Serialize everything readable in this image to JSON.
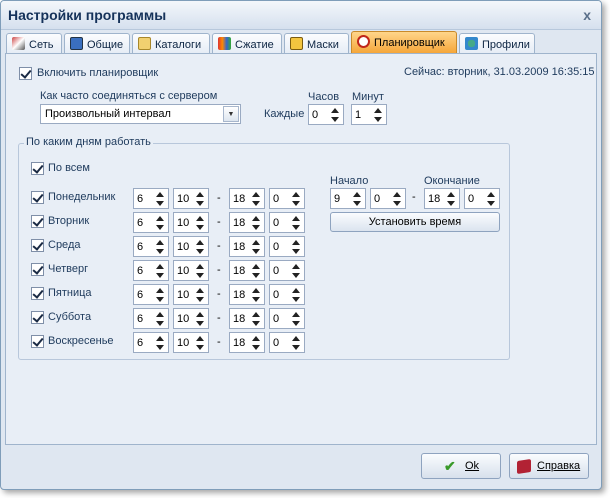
{
  "window": {
    "title": "Настройки программы",
    "close_glyph": "x"
  },
  "tabs": [
    {
      "label": "Сеть",
      "icon": "network-icon"
    },
    {
      "label": "Общие",
      "icon": "general-icon"
    },
    {
      "label": "Каталоги",
      "icon": "folders-icon"
    },
    {
      "label": "Сжатие",
      "icon": "compression-icon"
    },
    {
      "label": "Маски",
      "icon": "masks-icon"
    },
    {
      "label": "Планировщик",
      "icon": "clock-icon",
      "active": true
    },
    {
      "label": "Профили",
      "icon": "profiles-icon"
    }
  ],
  "scheduler": {
    "enable_label": "Включить планировщик",
    "enable_checked": true,
    "now_text": "Сейчас: вторник, 31.03.2009 16:35:15",
    "connect_label": "Как часто соединяться с сервером",
    "connect_value": "Произвольный интервал",
    "every_label": "Каждые",
    "hours_label": "Часов",
    "minutes_label": "Минут",
    "hours_value": "0",
    "minutes_value": "1"
  },
  "days_group": {
    "title": "По каким дням работать",
    "all_label": "По всем",
    "all_checked": true,
    "dash": "-",
    "days": [
      {
        "label": "Понедельник",
        "checked": true,
        "sh": "6",
        "sm": "10",
        "eh": "18",
        "em": "0"
      },
      {
        "label": "Вторник",
        "checked": true,
        "sh": "6",
        "sm": "10",
        "eh": "18",
        "em": "0"
      },
      {
        "label": "Среда",
        "checked": true,
        "sh": "6",
        "sm": "10",
        "eh": "18",
        "em": "0"
      },
      {
        "label": "Четверг",
        "checked": true,
        "sh": "6",
        "sm": "10",
        "eh": "18",
        "em": "0"
      },
      {
        "label": "Пятница",
        "checked": true,
        "sh": "6",
        "sm": "10",
        "eh": "18",
        "em": "0"
      },
      {
        "label": "Суббота",
        "checked": true,
        "sh": "6",
        "sm": "10",
        "eh": "18",
        "em": "0"
      },
      {
        "label": "Воскресенье",
        "checked": true,
        "sh": "6",
        "sm": "10",
        "eh": "18",
        "em": "0"
      }
    ],
    "start_label": "Начало",
    "end_label": "Окончание",
    "start_h": "9",
    "start_m": "0",
    "end_h": "18",
    "end_m": "0",
    "set_time_label": "Установить время"
  },
  "footer": {
    "ok_label": "Ok",
    "help_label": "Справка"
  }
}
